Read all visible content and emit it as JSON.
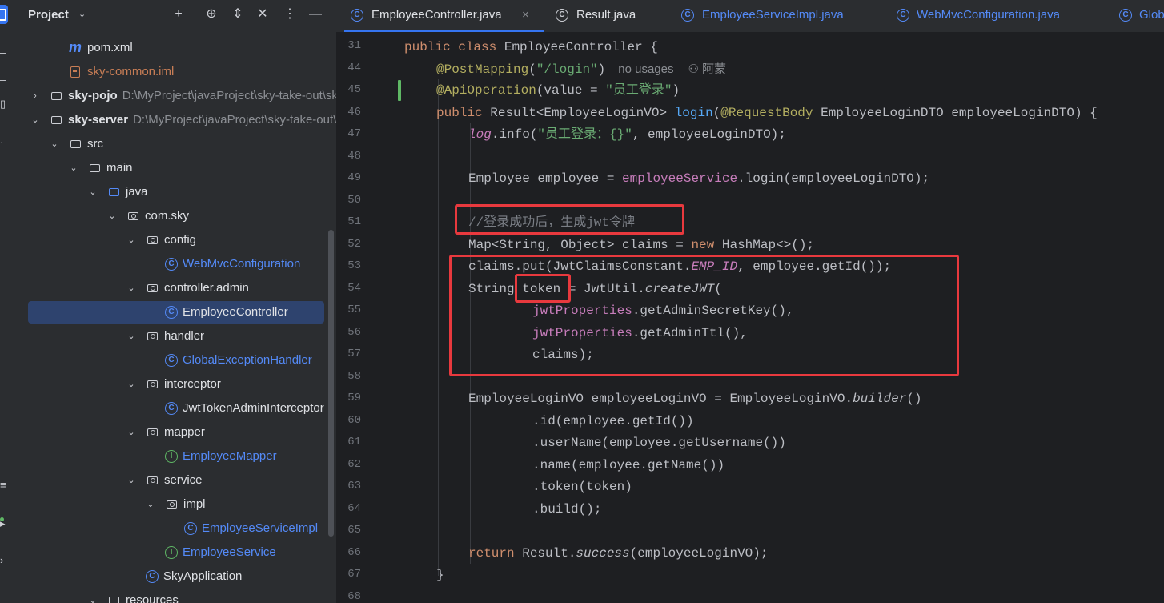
{
  "project_panel": {
    "title": "Project",
    "toolbar_icons": [
      "add-icon",
      "locate-icon",
      "expand-collapse-icon",
      "close-icon",
      "more-icon",
      "minimize-icon"
    ],
    "tree": [
      {
        "label": "pom.xml",
        "icon": "maven-icon",
        "path": ""
      },
      {
        "label": "sky-common.iml",
        "icon": "iml-file-icon",
        "path": ""
      },
      {
        "label": "sky-pojo",
        "icon": "module-folder-icon",
        "path": "D:\\MyProject\\javaProject\\sky-take-out\\sky-pojo"
      },
      {
        "label": "sky-server",
        "icon": "module-folder-icon",
        "path": "D:\\MyProject\\javaProject\\sky-take-out\\sky-server"
      },
      {
        "label": "src",
        "icon": "folder-icon",
        "path": ""
      },
      {
        "label": "main",
        "icon": "folder-icon",
        "path": ""
      },
      {
        "label": "java",
        "icon": "source-folder-icon",
        "path": ""
      },
      {
        "label": "com.sky",
        "icon": "package-icon",
        "path": ""
      },
      {
        "label": "config",
        "icon": "package-icon",
        "path": ""
      },
      {
        "label": "WebMvcConfiguration",
        "icon": "class-icon",
        "path": ""
      },
      {
        "label": "controller.admin",
        "icon": "package-icon",
        "path": ""
      },
      {
        "label": "EmployeeController",
        "icon": "class-icon",
        "path": ""
      },
      {
        "label": "handler",
        "icon": "package-icon",
        "path": ""
      },
      {
        "label": "GlobalExceptionHandler",
        "icon": "class-icon",
        "path": ""
      },
      {
        "label": "interceptor",
        "icon": "package-icon",
        "path": ""
      },
      {
        "label": "JwtTokenAdminInterceptor",
        "icon": "class-icon",
        "path": ""
      },
      {
        "label": "mapper",
        "icon": "package-icon",
        "path": ""
      },
      {
        "label": "EmployeeMapper",
        "icon": "interface-icon",
        "path": ""
      },
      {
        "label": "service",
        "icon": "package-icon",
        "path": ""
      },
      {
        "label": "impl",
        "icon": "package-icon",
        "path": ""
      },
      {
        "label": "EmployeeServiceImpl",
        "icon": "class-icon",
        "path": ""
      },
      {
        "label": "EmployeeService",
        "icon": "interface-icon",
        "path": ""
      },
      {
        "label": "SkyApplication",
        "icon": "spring-class-icon",
        "path": ""
      },
      {
        "label": "resources",
        "icon": "folder-icon",
        "path": ""
      }
    ],
    "selected": "EmployeeController"
  },
  "editor_tabs": [
    {
      "label": "EmployeeController.java",
      "active": true,
      "close": "×"
    },
    {
      "label": "Result.java",
      "active": false
    },
    {
      "label": "EmployeeServiceImpl.java",
      "active": false
    },
    {
      "label": "WebMvcConfiguration.java",
      "active": false
    },
    {
      "label": "GlobalExceptionHandler.java",
      "active": false
    }
  ],
  "editor": {
    "line_numbers": [
      "31",
      "44",
      "45",
      "46",
      "47",
      "48",
      "49",
      "50",
      "51",
      "52",
      "53",
      "54",
      "55",
      "56",
      "57",
      "58",
      "59",
      "60",
      "61",
      "62",
      "63",
      "64",
      "65",
      "66",
      "67",
      "68"
    ],
    "inlay_hint_usages": "no usages",
    "inlay_hint_author": "阿蒙",
    "code": {
      "l31": [
        "public",
        " ",
        "class",
        " EmployeeController {"
      ],
      "l44_ann": "@PostMapping",
      "l44_open": "(",
      "l44_str": "\"/login\"",
      "l44_close": ")",
      "l45_ann": "@ApiOperation",
      "l45_mid": "(value = ",
      "l45_str": "\"员工登录\"",
      "l45_close": ")",
      "l46_pub": "public",
      "l46_type": " Result<EmployeeLoginVO> ",
      "l46_fn": "login",
      "l46_open": "(",
      "l46_ann": "@RequestBody",
      "l46_rest": " EmployeeLoginDTO employeeLoginDTO) {",
      "l47_log": "log",
      "l47_mid": ".info(",
      "l47_str": "\"员工登录：{}\"",
      "l47_rest": ", employeeLoginDTO);",
      "l49_a": "Employee employee = ",
      "l49_field": "employeeService",
      "l49_b": ".login(employeeLoginDTO);",
      "l51_cmt": "//登录成功后，生成jwt令牌",
      "l52_a": "Map<String, Object> claims = ",
      "l52_new": "new",
      "l52_b": " HashMap<>();",
      "l53_a": "claims.put(JwtClaimsConstant.",
      "l53_const": "EMP_ID",
      "l53_b": ", employee.getId());",
      "l54_a": "String token = JwtUtil.",
      "l54_fn": "createJWT",
      "l54_b": "(",
      "l55_field": "jwtProperties",
      "l55_b": ".getAdminSecretKey(),",
      "l56_field": "jwtProperties",
      "l56_b": ".getAdminTtl(),",
      "l57": "claims);",
      "l59_a": "EmployeeLoginVO employeeLoginVO = EmployeeLoginVO.",
      "l59_fn": "builder",
      "l59_b": "()",
      "l60": ".id(employee.getId())",
      "l61": ".userName(employee.getUsername())",
      "l62": ".name(employee.getName())",
      "l63": ".token(token)",
      "l64": ".build();",
      "l66_kw": "return",
      "l66_a": " Result.",
      "l66_fn": "success",
      "l66_b": "(employeeLoginVO);",
      "l67": "}"
    }
  },
  "colors": {
    "highlight_box": "#e8393e",
    "accent": "#3574f0",
    "selection": "#2e436e"
  }
}
